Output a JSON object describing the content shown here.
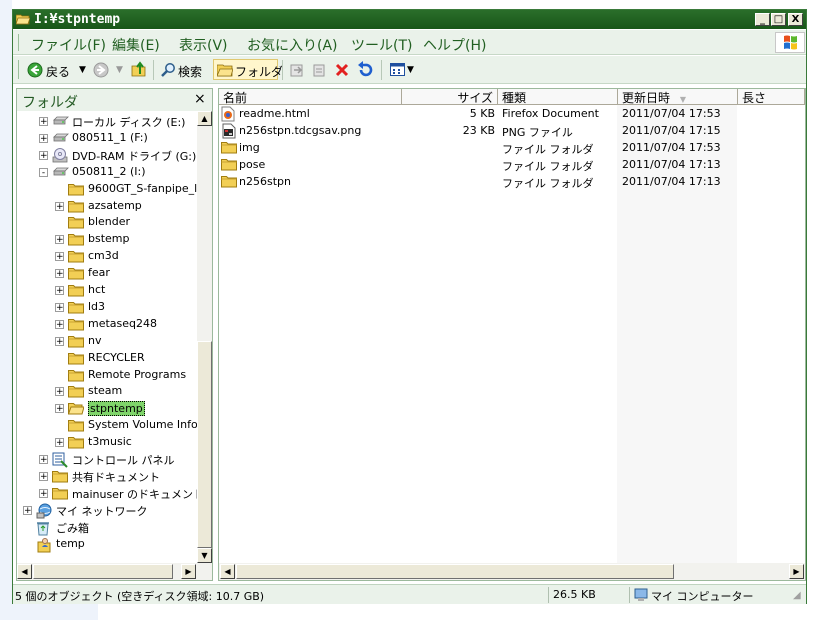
{
  "window": {
    "title": "I:¥stpntemp",
    "buttons": {
      "minimize": "_",
      "maximize": "□",
      "close": "X"
    }
  },
  "menubar": {
    "items": [
      "ファイル(F)",
      "編集(E)",
      "表示(V)",
      "お気に入り(A)",
      "ツール(T)",
      "ヘルプ(H)"
    ]
  },
  "toolbar": {
    "back": "戻る",
    "search": "検索",
    "folders": "フォルダ"
  },
  "folder_pane": {
    "title": "フォルダ",
    "close": "×",
    "tree": [
      {
        "label": "ローカル ディスク (E:)",
        "icon": "drive-icon",
        "depth": 2,
        "expander": "+"
      },
      {
        "label": "080511_1 (F:)",
        "icon": "drive-icon",
        "depth": 2,
        "expander": "+"
      },
      {
        "label": "DVD-RAM ドライブ (G:)",
        "icon": "cd-drive-icon",
        "depth": 2,
        "expander": "+"
      },
      {
        "label": "050811_2 (I:)",
        "icon": "drive-icon",
        "depth": 2,
        "expander": "-"
      },
      {
        "label": "9600GT_S-fanpipe_l",
        "icon": "folder-icon",
        "depth": 3,
        "expander": ""
      },
      {
        "label": "azsatemp",
        "icon": "folder-icon",
        "depth": 3,
        "expander": "+"
      },
      {
        "label": "blender",
        "icon": "folder-icon",
        "depth": 3,
        "expander": ""
      },
      {
        "label": "bstemp",
        "icon": "folder-icon",
        "depth": 3,
        "expander": "+"
      },
      {
        "label": "cm3d",
        "icon": "folder-icon",
        "depth": 3,
        "expander": "+"
      },
      {
        "label": "fear",
        "icon": "folder-icon",
        "depth": 3,
        "expander": "+"
      },
      {
        "label": "hct",
        "icon": "folder-icon",
        "depth": 3,
        "expander": "+"
      },
      {
        "label": "ld3",
        "icon": "folder-icon",
        "depth": 3,
        "expander": "+"
      },
      {
        "label": "metaseq248",
        "icon": "folder-icon",
        "depth": 3,
        "expander": "+"
      },
      {
        "label": "nv",
        "icon": "folder-icon",
        "depth": 3,
        "expander": "+"
      },
      {
        "label": "RECYCLER",
        "icon": "folder-icon",
        "depth": 3,
        "expander": ""
      },
      {
        "label": "Remote Programs",
        "icon": "folder-icon",
        "depth": 3,
        "expander": ""
      },
      {
        "label": "steam",
        "icon": "folder-icon",
        "depth": 3,
        "expander": "+"
      },
      {
        "label": "stpntemp",
        "icon": "open-folder-icon",
        "depth": 3,
        "expander": "+",
        "selected": true
      },
      {
        "label": "System Volume Info",
        "icon": "folder-icon",
        "depth": 3,
        "expander": ""
      },
      {
        "label": "t3music",
        "icon": "folder-icon",
        "depth": 3,
        "expander": "+"
      },
      {
        "label": "コントロール パネル",
        "icon": "control-panel-icon",
        "depth": 2,
        "expander": "+"
      },
      {
        "label": "共有ドキュメント",
        "icon": "folder-icon",
        "depth": 2,
        "expander": "+"
      },
      {
        "label": "mainuser のドキュメント",
        "icon": "folder-icon",
        "depth": 2,
        "expander": "+"
      },
      {
        "label": "マイ ネットワーク",
        "icon": "network-icon",
        "depth": 1,
        "expander": "+"
      },
      {
        "label": "ごみ箱",
        "icon": "recycle-bin-icon",
        "depth": 1,
        "expander": ""
      },
      {
        "label": "temp",
        "icon": "user-folder-icon",
        "depth": 1,
        "expander": ""
      }
    ]
  },
  "file_list": {
    "columns": [
      "名前",
      "サイズ",
      "種類",
      "更新日時",
      "長さ"
    ],
    "rows": [
      {
        "name": "readme.html",
        "size": "5 KB",
        "type": "Firefox Document",
        "date": "2011/07/04 17:53",
        "icon": "html-file-icon"
      },
      {
        "name": "n256stpn.tdcgsav.png",
        "size": "23 KB",
        "type": "PNG ファイル",
        "date": "2011/07/04 17:15",
        "icon": "png-file-icon"
      },
      {
        "name": "img",
        "size": "",
        "type": "ファイル フォルダ",
        "date": "2011/07/04 17:53",
        "icon": "folder-icon"
      },
      {
        "name": "pose",
        "size": "",
        "type": "ファイル フォルダ",
        "date": "2011/07/04 17:13",
        "icon": "folder-icon"
      },
      {
        "name": "n256stpn",
        "size": "",
        "type": "ファイル フォルダ",
        "date": "2011/07/04 17:13",
        "icon": "folder-icon"
      }
    ]
  },
  "statusbar": {
    "objects": "5 個のオブジェクト (空きディスク領域: 10.7 GB)",
    "size": "26.5 KB",
    "location": "マイ コンピューター"
  },
  "colors": {
    "titlebar": "#1f631f",
    "menu_text": "#215f21",
    "selection": "#7fd46a",
    "folder": "#f2cf55"
  }
}
